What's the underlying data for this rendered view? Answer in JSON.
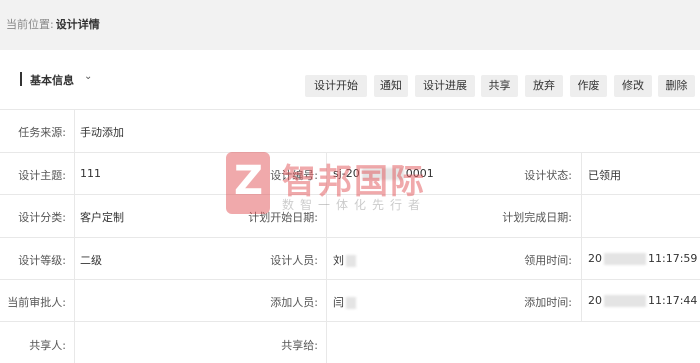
{
  "breadcrumb": {
    "label": "当前位置:",
    "current": "设计详情"
  },
  "section": {
    "title": "基本信息",
    "chevron": "⌄"
  },
  "toolbar": [
    {
      "label": "设计开始"
    },
    {
      "label": "通知"
    },
    {
      "label": "设计进展"
    },
    {
      "label": "共享"
    },
    {
      "label": "放弃"
    },
    {
      "label": "作废"
    },
    {
      "label": "修改"
    },
    {
      "label": "删除"
    }
  ],
  "fields": {
    "source": {
      "label": "任务来源:",
      "value": "手动添加"
    },
    "subject": {
      "label": "设计主题:",
      "value": "111"
    },
    "code": {
      "label": "设计编号:",
      "value_a": "sj-20",
      "value_b": "0001"
    },
    "status": {
      "label": "设计状态:",
      "value": "已领用"
    },
    "category": {
      "label": "设计分类:",
      "value": "客户定制"
    },
    "plan_start": {
      "label": "计划开始日期:",
      "value": ""
    },
    "plan_end": {
      "label": "计划完成日期:",
      "value": ""
    },
    "level": {
      "label": "设计等级:",
      "value": "二级"
    },
    "designer": {
      "label": "设计人员:",
      "value": "刘"
    },
    "claim_time": {
      "label": "领用时间:",
      "value_a": "20",
      "value_b": "11:17:59"
    },
    "approver": {
      "label": "当前审批人:",
      "value": ""
    },
    "adder": {
      "label": "添加人员:",
      "value": "闫"
    },
    "add_time": {
      "label": "添加时间:",
      "value_a": "20",
      "value_b": "11:17:44"
    },
    "sharer": {
      "label": "共享人:",
      "value": ""
    },
    "shared_to": {
      "label": "共享给:",
      "value": ""
    }
  },
  "watermark": {
    "logo_letter": "Z",
    "name": "智邦国际",
    "slogan": "数智一体化先行者",
    "color": "#e3565a"
  }
}
